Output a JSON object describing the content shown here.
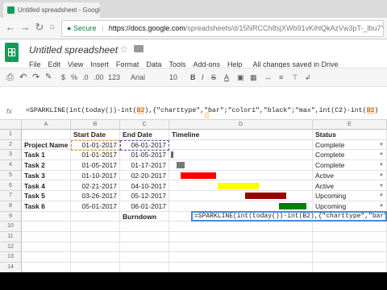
{
  "browser": {
    "tab_title": "Untitled spreadsheet - Google She",
    "secure_label": "Secure",
    "url_host": "https://docs.google.com",
    "url_path": "/spreadsheets/d/15NRCCh8sjXWb91vKihlQkAzVw3pT-_lbu7YkHHZHFo"
  },
  "doc": {
    "title": "Untitled spreadsheet",
    "saved_status": "All changes saved in Drive"
  },
  "menu": [
    "File",
    "Edit",
    "View",
    "Insert",
    "Format",
    "Data",
    "Tools",
    "Add-ons",
    "Help"
  ],
  "toolbar": {
    "currency": "$",
    "percent": "%",
    ".0": ".0",
    ".00": ".00",
    "format_more": "123",
    "font": "Arial",
    "size": "10"
  },
  "formula": {
    "fx_label": "fx",
    "text_a": "=SPARKLINE(int(today())-int(",
    "ref_a": "B2",
    "text_b": "),{\"charttype\",\"bar\";\"color1\",\"black\";\"max\",int(C2)-int(",
    "ref_b": "B2",
    "text_c": ")"
  },
  "edit_cell_text": "=SPARKLINE(int(today())-int(B2),{\"charttype\",\"bar\";\"color1\",\"bl",
  "columns": [
    "A",
    "B",
    "C",
    "D",
    "E"
  ],
  "rows": [
    "1",
    "2",
    "3",
    "4",
    "5",
    "6",
    "7",
    "8",
    "9",
    "10",
    "11",
    "12",
    "13",
    "14"
  ],
  "table": {
    "headers": {
      "b": "Start Date",
      "c": "End Date",
      "d": "Timeline",
      "e": "Status"
    },
    "data": [
      {
        "a": "Project Name",
        "b": "01-01-2017",
        "c": "06-01-2017",
        "e": "Complete"
      },
      {
        "a": "Task 1",
        "b": "01-01-2017",
        "c": "01-05-2017",
        "e": "Complete"
      },
      {
        "a": "Task 2",
        "b": "01-05-2017",
        "c": "01-17-2017",
        "e": "Complete"
      },
      {
        "a": "Task 3",
        "b": "01-10-2017",
        "c": "02-20-2017",
        "e": "Active"
      },
      {
        "a": "Task 4",
        "b": "02-21-2017",
        "c": "04-10-2017",
        "e": "Active"
      },
      {
        "a": "Task 5",
        "b": "03-26-2017",
        "c": "05-12-2017",
        "e": "Upcoming"
      },
      {
        "a": "Task 6",
        "b": "05-01-2017",
        "c": "06-01-2017",
        "e": "Upcoming"
      }
    ],
    "burndown_label": "Burndown"
  },
  "timeline_bars": [
    {
      "start": 0.0,
      "len": 0.02,
      "color": "#666666"
    },
    {
      "start": 0.04,
      "len": 0.06,
      "color": "#777777"
    },
    {
      "start": 0.07,
      "len": 0.26,
      "color": "#ff0000"
    },
    {
      "start": 0.34,
      "len": 0.3,
      "color": "#ffff00"
    },
    {
      "start": 0.54,
      "len": 0.3,
      "color": "#990000"
    },
    {
      "start": 0.79,
      "len": 0.2,
      "color": "#008000"
    }
  ]
}
